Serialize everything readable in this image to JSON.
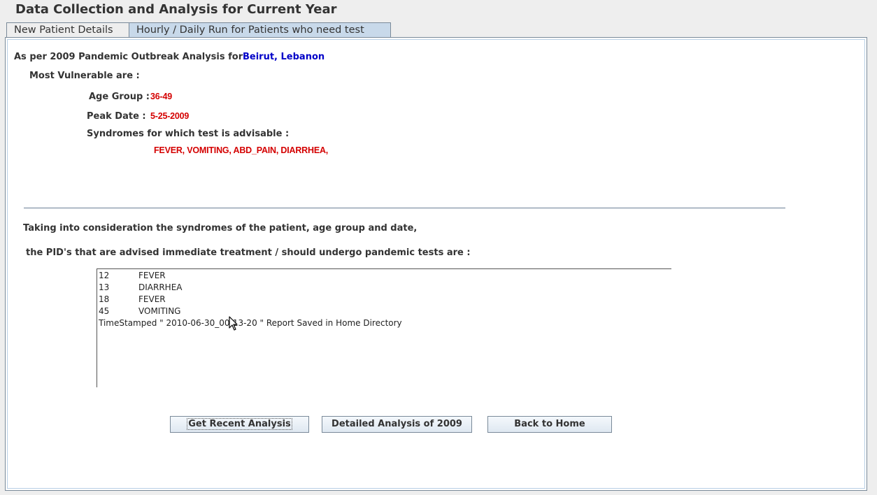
{
  "window": {
    "title": "Data Collection and Analysis for Current Year"
  },
  "tabs": [
    {
      "label": "New Patient Details",
      "selected": false
    },
    {
      "label": "Hourly / Daily Run for Patients who need test",
      "selected": true
    }
  ],
  "analysis": {
    "intro": "As per 2009 Pandemic Outbreak Analysis for",
    "location": "Beirut, Lebanon",
    "vulnerable_label": "Most Vulnerable are :",
    "age_group_label": "Age Group :",
    "age_group_value": "36-49",
    "peak_date_label": "Peak Date :",
    "peak_date_value": "5-25-2009",
    "syndromes_label": "Syndromes for which test is advisable :",
    "syndromes_value": "FEVER, VOMITING, ABD_PAIN, DIARRHEA,"
  },
  "consideration": {
    "line1": "Taking into consideration the syndromes of the patient, age group and date,",
    "line2": "the PID's that are advised immediate treatment / should undergo pandemic tests are :"
  },
  "results": {
    "rows": [
      {
        "pid": "12",
        "syndrome": "FEVER"
      },
      {
        "pid": "13",
        "syndrome": "DIARRHEA"
      },
      {
        "pid": "18",
        "syndrome": "FEVER"
      },
      {
        "pid": "45",
        "syndrome": "VOMITING"
      }
    ],
    "timestamp_line": "TimeStamped \" 2010-06-30_00-13-20 \" Report Saved in Home Directory"
  },
  "buttons": {
    "recent": "Get Recent Analysis",
    "detailed": "Detailed Analysis of 2009",
    "home": "Back to Home"
  },
  "colors": {
    "location": "#0000c8",
    "highlight": "#d40000",
    "selected_tab": "#c8d9ea"
  }
}
